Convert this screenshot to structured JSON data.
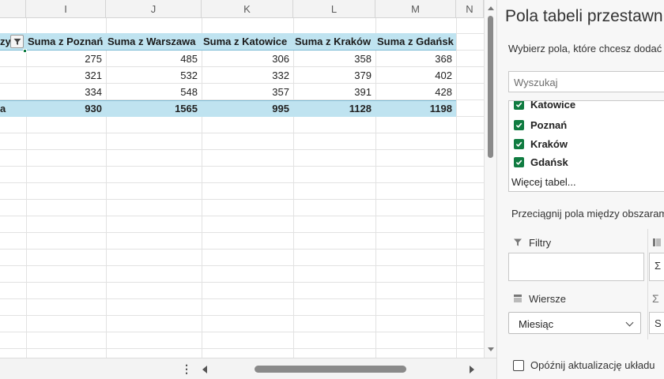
{
  "sheet": {
    "columns": [
      "I",
      "J",
      "K",
      "L",
      "M",
      "N"
    ],
    "pivot": {
      "row_header_fragment": "zy",
      "headers": [
        "Suma z Poznań",
        "Suma z Warszawa",
        "Suma z Katowice",
        "Suma z Kraków",
        "Suma z Gdańsk"
      ],
      "rows": [
        [
          275,
          485,
          306,
          358,
          368
        ],
        [
          321,
          532,
          332,
          379,
          402
        ],
        [
          334,
          548,
          357,
          391,
          428
        ]
      ],
      "total_label_fragment": "a",
      "totals": [
        930,
        1565,
        995,
        1128,
        1198
      ]
    },
    "header_fill_color": "#bfe3f0",
    "scroll_dots": "⋮"
  },
  "pane": {
    "title": "Pola tabeli przestawn",
    "subtitle": "Wybierz pola, które chcesz dodać d",
    "search_placeholder": "Wyszukaj",
    "fields_partial_top": "Katowice",
    "fields": [
      {
        "label": "Poznań",
        "checked": true
      },
      {
        "label": "Kraków",
        "checked": true
      },
      {
        "label": "Gdańsk",
        "checked": true
      }
    ],
    "more_tables": "Więcej tabel...",
    "drag_hint": "Przeciągnij pola między obszarami",
    "areas": {
      "filters_label": "Filtry",
      "rows_label": "Wiersze",
      "rows_value": "Miesiąc",
      "values_partial": "S"
    },
    "defer_label": "Opóźnij aktualizację układu",
    "accent_color": "#107c41"
  }
}
